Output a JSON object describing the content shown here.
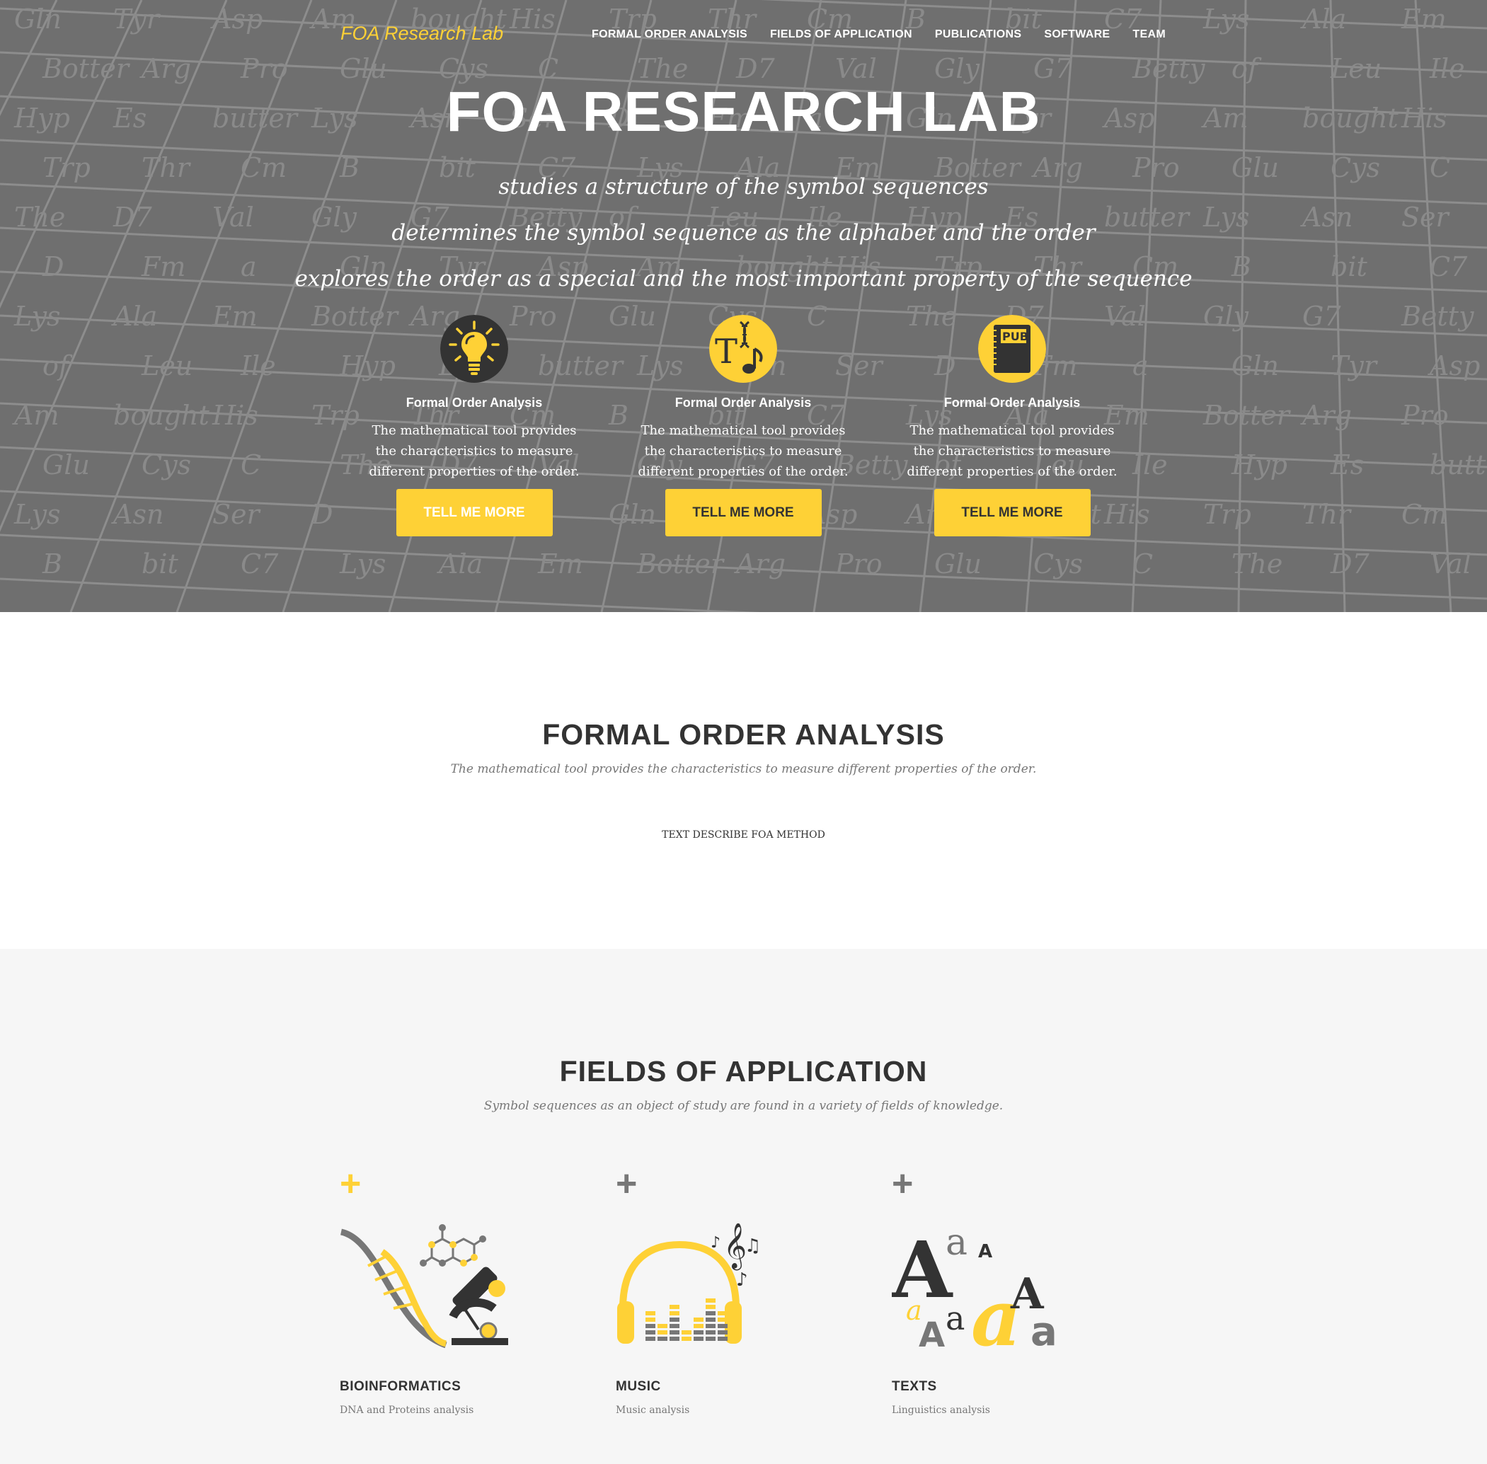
{
  "navbar": {
    "brand": "FOA Research Lab",
    "links": [
      {
        "label": "FORMAL ORDER ANALYSIS"
      },
      {
        "label": "FIELDS OF APPLICATION"
      },
      {
        "label": "PUBLICATIONS"
      },
      {
        "label": "SOFTWARE"
      },
      {
        "label": "TEAM"
      }
    ]
  },
  "hero": {
    "title": "FOA RESEARCH LAB",
    "lines": [
      "studies a structure of the symbol sequences",
      "determines the symbol sequence as the alphabet and the order",
      "explores the order as a special and the most important property of the sequence"
    ],
    "background_words": [
      "Gln",
      "Leu",
      "Pro",
      "Trp",
      "Asn",
      "Val",
      "Lys",
      "Tyr",
      "Ile",
      "Glu",
      "Thr",
      "Ser",
      "Gly",
      "Ala",
      "Asp",
      "Hyp",
      "Cys",
      "Cm",
      "D",
      "G7",
      "Em",
      "Am",
      "Es",
      "C",
      "B",
      "Fm",
      "Betty",
      "Botter",
      "bought",
      "butter",
      "The",
      "bit",
      "a",
      "of",
      "Arg",
      "His",
      "Lys",
      "D7",
      "C7"
    ],
    "services": [
      {
        "icon": "lightbulb-icon",
        "title": "Formal Order Analysis",
        "text": "The mathematical tool provides the characteristics to measure different properties of the order.",
        "button": "TELL ME MORE"
      },
      {
        "icon": "text-dna-music-icon",
        "title": "Formal Order Analysis",
        "text": "The mathematical tool provides the characteristics to measure different properties of the order.",
        "button": "TELL ME MORE"
      },
      {
        "icon": "publications-book-icon",
        "icon_label": "PUB",
        "title": "Formal Order Analysis",
        "text": "The mathematical tool provides the characteristics to measure different properties of the order.",
        "button": "TELL ME MORE"
      }
    ]
  },
  "foa": {
    "heading": "FORMAL ORDER ANALYSIS",
    "subheading": "The mathematical tool provides the characteristics to measure different properties of the order.",
    "text": "TEXT DESCRIBE FOA METHOD"
  },
  "fields": {
    "heading": "FIELDS OF APPLICATION",
    "subheading": "Symbol sequences as an object of study are found in a variety of fields of knowledge.",
    "items": [
      {
        "icon": "bioinformatics-icon",
        "title": "BIOINFORMATICS",
        "desc": "DNA and Proteins analysis"
      },
      {
        "icon": "music-headphones-icon",
        "title": "MUSIC",
        "desc": "Music analysis"
      },
      {
        "icon": "texts-letters-icon",
        "title": "TEXTS",
        "desc": "Linguistics analysis",
        "glyphs": [
          "A",
          "a",
          "A",
          "a",
          "a",
          "A",
          "a",
          "A",
          "a"
        ]
      }
    ]
  },
  "colors": {
    "accent": "#fed136",
    "hero_bg": "#6f6f6f",
    "dark": "#333333",
    "muted": "#777777",
    "section_bg": "#f6f6f6"
  }
}
